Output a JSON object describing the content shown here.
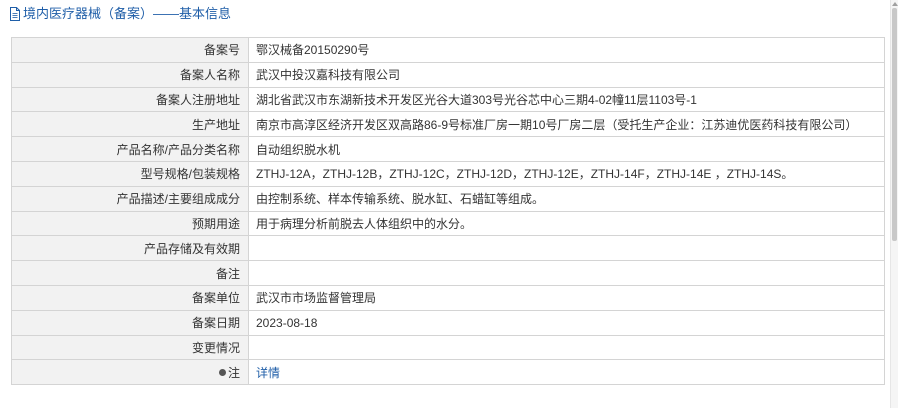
{
  "header": {
    "title": "境内医疗器械（备案）——基本信息",
    "icon": "document-icon",
    "title_color": "#1f5ea8"
  },
  "rows": [
    {
      "label": "备案号",
      "value": "鄂汉械备20150290号"
    },
    {
      "label": "备案人名称",
      "value": "武汉中投汉嘉科技有限公司"
    },
    {
      "label": "备案人注册地址",
      "value": "湖北省武汉市东湖新技术开发区光谷大道303号光谷芯中心三期4-02幢11层1103号-1"
    },
    {
      "label": "生产地址",
      "value": "南京市高淳区经济开发区双高路86-9号标准厂房一期10号厂房二层（受托生产企业：江苏迪优医药科技有限公司）"
    },
    {
      "label": "产品名称/产品分类名称",
      "value": "自动组织脱水机"
    },
    {
      "label": "型号规格/包装规格",
      "value": "ZTHJ-12A，ZTHJ-12B，ZTHJ-12C，ZTHJ-12D，ZTHJ-12E，ZTHJ-14F，ZTHJ-14E ，ZTHJ-14S。"
    },
    {
      "label": "产品描述/主要组成成分",
      "value": "由控制系统、样本传输系统、脱水缸、石蜡缸等组成。"
    },
    {
      "label": "预期用途",
      "value": "用于病理分析前脱去人体组织中的水分。"
    },
    {
      "label": "产品存储及有效期",
      "value": ""
    },
    {
      "label": "备注",
      "value": ""
    },
    {
      "label": "备案单位",
      "value": "武汉市市场监督管理局"
    },
    {
      "label": "备案日期",
      "value": "2023-08-18"
    },
    {
      "label": "变更情况",
      "value": ""
    }
  ],
  "note_row": {
    "label": "注",
    "link_text": "详情",
    "icon": "bullet-dot-icon",
    "link_color": "#1f5ea8"
  },
  "colors": {
    "label_bg": "#f2f2f2",
    "border": "#d4d4d4",
    "text": "#333333"
  }
}
